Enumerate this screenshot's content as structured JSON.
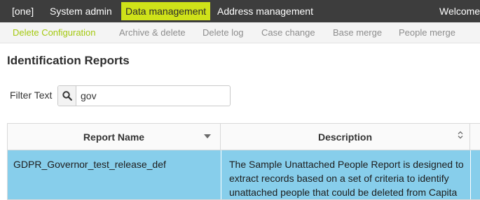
{
  "topnav": {
    "items": [
      {
        "label": "[one]",
        "active": false
      },
      {
        "label": "System admin",
        "active": false
      },
      {
        "label": "Data management",
        "active": true
      },
      {
        "label": "Address management",
        "active": false
      }
    ],
    "welcome": "Welcome"
  },
  "subnav": {
    "items": [
      {
        "label": "Delete Configuration",
        "active": true
      },
      {
        "label": "Archive & delete",
        "active": false
      },
      {
        "label": "Delete log",
        "active": false
      },
      {
        "label": "Case change",
        "active": false
      },
      {
        "label": "Base merge",
        "active": false
      },
      {
        "label": "People merge",
        "active": false
      }
    ]
  },
  "page": {
    "title": "Identification Reports"
  },
  "filter": {
    "label": "Filter Text",
    "value": "gov",
    "icon": "search-icon"
  },
  "table": {
    "columns": [
      {
        "label": "Report Name",
        "sort": "descending"
      },
      {
        "label": "Description",
        "sort": "none"
      }
    ],
    "rows": [
      {
        "name": "GDPR_Governor_test_release_def",
        "description": "The Sample Unattached People Report is designed to extract records based on a set of criteria to identify unattached people that could be deleted from Capita",
        "selected": true
      }
    ]
  },
  "colors": {
    "topbar": "#3d3d3d",
    "accent": "#cfe219",
    "subnav_active": "#a4c90f",
    "selected_row": "#87ceeb"
  }
}
